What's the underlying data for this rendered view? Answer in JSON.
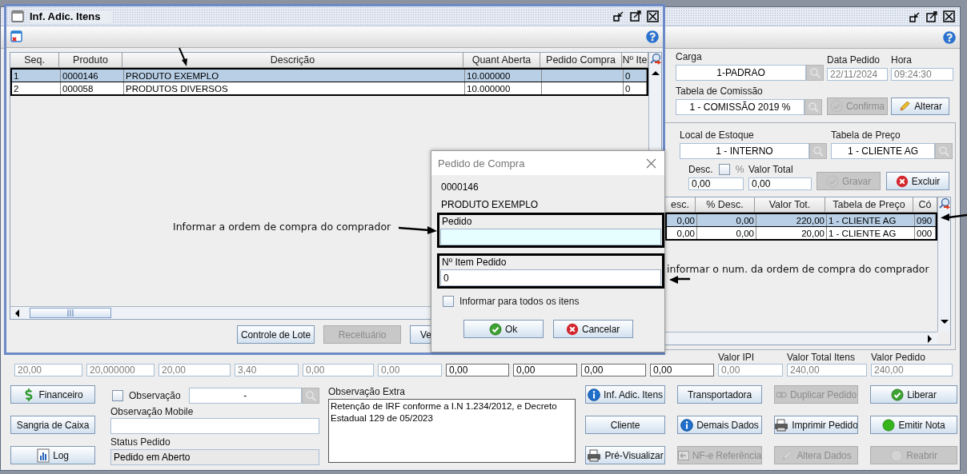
{
  "main_window": {
    "carga": {
      "label": "Carga",
      "value": "1-PADRAO"
    },
    "data_pedido": {
      "label": "Data Pedido",
      "value": "22/11/2024"
    },
    "hora": {
      "label": "Hora",
      "value": "09:24:30"
    },
    "tabela_comissao": {
      "label": "Tabela de Comissão",
      "value": "1 - COMISSÃO 2019 %"
    },
    "header_buttons": [
      {
        "label": "Confirma",
        "kind": "check",
        "disabled": true
      },
      {
        "label": "Alterar",
        "kind": "pencil",
        "disabled": false
      }
    ],
    "item_panel": {
      "local_estoque": {
        "label": "Local de Estoque",
        "value": "1 - INTERNO"
      },
      "tabela_preco": {
        "label": "Tabela de Preço",
        "value": "1 - CLIENTE AG"
      },
      "desc": {
        "label": "Desc.",
        "value": "0,00"
      },
      "percent": {
        "label": "%",
        "checked": false
      },
      "valor_total": {
        "label": "Valor Total",
        "value": "0,00"
      },
      "buttons": [
        {
          "label": "Gravar",
          "kind": "check",
          "disabled": true
        },
        {
          "label": "Excluir",
          "kind": "cancel",
          "disabled": false
        }
      ],
      "table": {
        "columns": [
          "esc.",
          "% Desc.",
          "Valor Tot.",
          "Tabela de Preço",
          "Có"
        ],
        "rows": [
          {
            "selected": true,
            "cells": [
              "0,00",
              "0,00",
              "220,00",
              "1 - CLIENTE AG",
              "090"
            ]
          },
          {
            "selected": false,
            "cells": [
              "0,00",
              "0,00",
              "20,00",
              "1 - CLIENTE AG",
              "000"
            ]
          }
        ]
      }
    },
    "totals": [
      {
        "value": "20,00",
        "editable": false
      },
      {
        "value": "20,000000",
        "editable": false
      },
      {
        "value": "20,00",
        "editable": false
      },
      {
        "value": "3,40",
        "editable": false
      },
      {
        "value": "0,00",
        "editable": false
      },
      {
        "value": "0,00",
        "editable": false
      },
      {
        "value": "0,00",
        "editable": true
      },
      {
        "value": "0,00",
        "editable": true
      },
      {
        "value": "0,00",
        "editable": true
      },
      {
        "value": "0,00",
        "editable": true
      },
      {
        "label": "Valor IPI",
        "value": "0,00",
        "editable": false
      },
      {
        "label": "Valor Total Itens",
        "value": "240,00",
        "editable": false
      },
      {
        "label": "Valor Pedido",
        "value": "240,00",
        "editable": false
      }
    ],
    "left_buttons": [
      {
        "label": "Financeiro",
        "kind": "dollar"
      },
      {
        "label": "Sangria de Caixa"
      },
      {
        "label": "Log",
        "kind": "chart"
      }
    ],
    "observacao": {
      "label": "Observação",
      "checked": false,
      "value": "-"
    },
    "observacao_mobile": {
      "label": "Observação Mobile"
    },
    "status_pedido": {
      "label": "Status Pedido",
      "value": "Pedido em Aberto"
    },
    "observacao_extra": {
      "label": "Observação Extra",
      "value": "Retenção de IRF conforme a I.N 1.234/2012, e Decreto Estadual 129 de 05/2023"
    },
    "action_buttons": [
      {
        "label": "Inf. Adic. Itens",
        "kind": "info",
        "disabled": false
      },
      {
        "label": "Transportadora",
        "disabled": false
      },
      {
        "label": "Duplicar Pedido",
        "kind": "link",
        "disabled": true
      },
      {
        "label": "Liberar",
        "kind": "check",
        "disabled": false
      },
      {
        "label": "Cliente",
        "disabled": false
      },
      {
        "label": "Demais Dados",
        "kind": "info",
        "disabled": false
      },
      {
        "label": "Imprimir Pedido",
        "kind": "printer",
        "disabled": false
      },
      {
        "label": "Emitir Nota",
        "kind": "dot",
        "disabled": false
      },
      {
        "label": "Pré-Visualizar",
        "kind": "printer",
        "disabled": false
      },
      {
        "label": "NF-e Referência",
        "kind": "doc",
        "disabled": true
      },
      {
        "label": "Altera Dados",
        "kind": "pencil",
        "disabled": true
      },
      {
        "label": "Reabrir",
        "kind": "dot",
        "disabled": true
      }
    ]
  },
  "frame": {
    "title": "Inf. Adic. Itens",
    "table": {
      "columns": [
        "Seq.",
        "Produto",
        "Descrição",
        "Quant Aberta",
        "Pedido Compra",
        "Nº Ite"
      ],
      "rows": [
        {
          "selected": true,
          "cells": [
            "1",
            "0000146",
            "PRODUTO EXEMPLO",
            "10.000000",
            null,
            "0"
          ]
        },
        {
          "selected": false,
          "cells": [
            "2",
            "000058",
            "PRODUTOS DIVERSOS",
            "10.000000",
            null,
            "0"
          ]
        }
      ]
    },
    "buttons": [
      {
        "label": "Controle de Lote",
        "disabled": false
      },
      {
        "label": "Receituário",
        "disabled": true
      },
      {
        "label": "Ve",
        "disabled": false
      }
    ]
  },
  "dialog": {
    "title": "Pedido de Compra",
    "code": "0000146",
    "product": "PRODUTO EXEMPLO",
    "fields": [
      {
        "label": "Pedido",
        "focused": true
      },
      {
        "label": "Nº Item Pedido",
        "value": "0",
        "focused": false
      }
    ],
    "all_items": {
      "label": "Informar para todos os itens",
      "checked": false
    },
    "buttons": [
      {
        "label": "Ok",
        "kind": "check"
      },
      {
        "label": "Cancelar",
        "kind": "cancel"
      }
    ]
  },
  "annotations": [
    {
      "text": "Informar a ordem de compra do comprador"
    },
    {
      "text": "informar o num. da ordem de compra do comprador"
    }
  ]
}
